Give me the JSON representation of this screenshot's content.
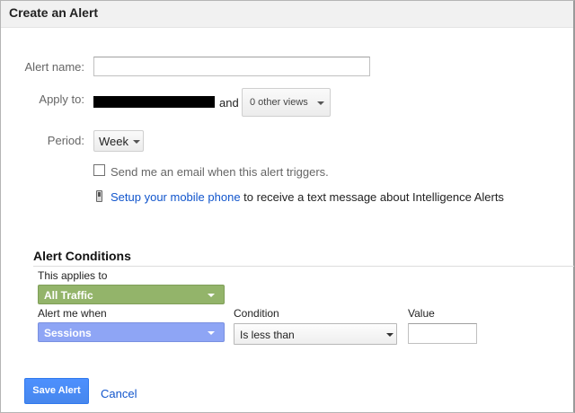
{
  "dialog": {
    "title": "Create an Alert"
  },
  "form": {
    "alert_name_label": "Alert name:",
    "alert_name_value": "",
    "apply_to_label": "Apply to:",
    "and_text": "and",
    "views_dropdown": "0 other views",
    "period_label": "Period:",
    "period_value": "Week",
    "email_checkbox_label": "Send me an email when this alert triggers.",
    "email_checked": false,
    "mobile_link": "Setup your mobile phone",
    "mobile_text": " to receive a text message about Intelligence Alerts"
  },
  "conditions": {
    "title": "Alert Conditions",
    "applies_to_label": "This applies to",
    "applies_to_value": "All Traffic",
    "alert_when_label": "Alert me when",
    "alert_when_value": "Sessions",
    "condition_label": "Condition",
    "condition_value": "Is less than",
    "value_label": "Value",
    "value_value": ""
  },
  "actions": {
    "save_label": "Save Alert",
    "cancel_label": "Cancel"
  },
  "colors": {
    "applies_to_bg": "#93b46a",
    "alert_when_bg": "#8ea5f5",
    "save_button": "#4d90fe",
    "link": "#1155cc"
  },
  "icons": {
    "views_dropdown": "chevron-down-icon",
    "period": "chevron-down-icon",
    "mobile": "mobile-phone-icon"
  }
}
